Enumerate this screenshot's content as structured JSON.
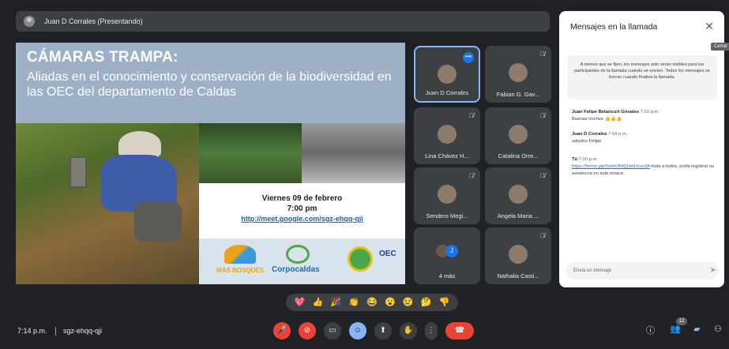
{
  "presenter": {
    "name": "Juan D Corrales (Presentando)"
  },
  "slide": {
    "title": "CÁMARAS TRAMPA:",
    "subtitle": "Aliadas en el conocimiento y conservación de la biodiversidad en las OEC del departamento de Caldas",
    "date": "Viernes 09 de febrero",
    "time": "7:00 pm",
    "link": "http://meet.google.com/sgz-ehqq-qji",
    "logos": [
      "MÁS BOSQUES",
      "Corpocaldas",
      "OEC"
    ]
  },
  "participants": [
    {
      "name": "Juan D Corrales",
      "muted": false,
      "active": true
    },
    {
      "name": "Fabian G. Gav...",
      "muted": true
    },
    {
      "name": "Lina Chávez H...",
      "muted": true
    },
    {
      "name": "Catalina Orre...",
      "muted": true
    },
    {
      "name": "Sendero Megi...",
      "muted": true
    },
    {
      "name": "Angela Maria ...",
      "muted": true
    },
    {
      "name": "4 más",
      "extra_initial": "J"
    },
    {
      "name": "Nathalia Casti...",
      "muted": true
    }
  ],
  "chat": {
    "title": "Mensajes en la llamada",
    "close_tooltip": "Cerrar",
    "notice": "A menos que se fijen, los mensajes solo serán visibles para los participantes de la llamada cuando se envíen. Todos los mensajes se borran cuando finaliza la llamada.",
    "messages": [
      {
        "sender": "Juan Felipe Betancurt Grisales",
        "time": "7:03 p.m.",
        "text": "Buenas noches 👍👍👍"
      },
      {
        "sender": "Juan D Corrales",
        "time": "7:04 p.m.",
        "text": "saludos Felipe"
      },
      {
        "sender": "Tú",
        "time": "7:10 p.m.",
        "link": "https://forms.gle/SwtHJKtQUetLKocZA",
        "text": " Hola a todos, porfa registrar su asistencia en este enlace"
      }
    ],
    "input_placeholder": "Envía un mensaje"
  },
  "reactions": [
    "💖",
    "👍",
    "🎉",
    "👏",
    "😂",
    "😮",
    "😢",
    "🤔",
    "👎"
  ],
  "bottom": {
    "clock": "7:14 p.m.",
    "meeting_code": "sgz-ehqq-qji",
    "participant_count": "12"
  },
  "colors": {
    "background": "#202124",
    "tile": "#3c4043",
    "accent": "#8ab4f8",
    "danger": "#ea4335"
  }
}
